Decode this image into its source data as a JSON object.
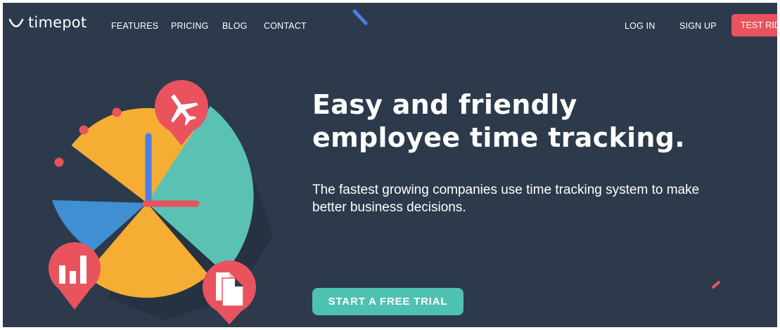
{
  "brand": {
    "name": "timepot"
  },
  "nav": {
    "links": [
      "FEATURES",
      "PRICING",
      "BLOG",
      "CONTACT"
    ],
    "login": "LOG IN",
    "signup": "SIGN UP",
    "test_ride": "TEST RIDE"
  },
  "hero": {
    "headline_line1": "Easy and friendly",
    "headline_line2": "employee time tracking.",
    "subtitle_line1": "The fastest growing companies use time tracking system to make",
    "subtitle_line2": "better business decisions.",
    "cta": "START A FREE TRIAL"
  },
  "colors": {
    "background": "#2c3a4b",
    "accent_red": "#e9535e",
    "accent_teal": "#4fc1b1",
    "clock_orange": "#f5ad33",
    "clock_blue": "#3f8fd2",
    "hand_blue": "#4a7ee6"
  },
  "icons": [
    "smile-logo-icon",
    "airplane-icon",
    "bar-chart-icon",
    "document-icon"
  ]
}
